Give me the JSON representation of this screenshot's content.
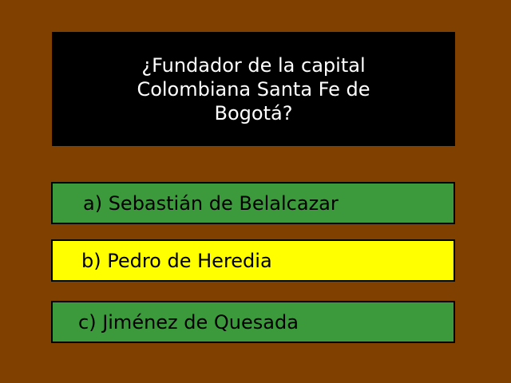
{
  "colors": {
    "background": "#7f4000",
    "question_box": "#000000",
    "question_text": "#ffffff",
    "answer_default": "#3c9a3c",
    "answer_selected": "#ffff00"
  },
  "question": {
    "text": "¿Fundador de la capital Colombiana Santa Fe de Bogotá?"
  },
  "answers": [
    {
      "label": "a) Sebastián de Belalcazar",
      "selected": false
    },
    {
      "label": "b) Pedro de Heredia",
      "selected": true
    },
    {
      "label": "c) Jiménez de Quesada",
      "selected": false
    }
  ]
}
